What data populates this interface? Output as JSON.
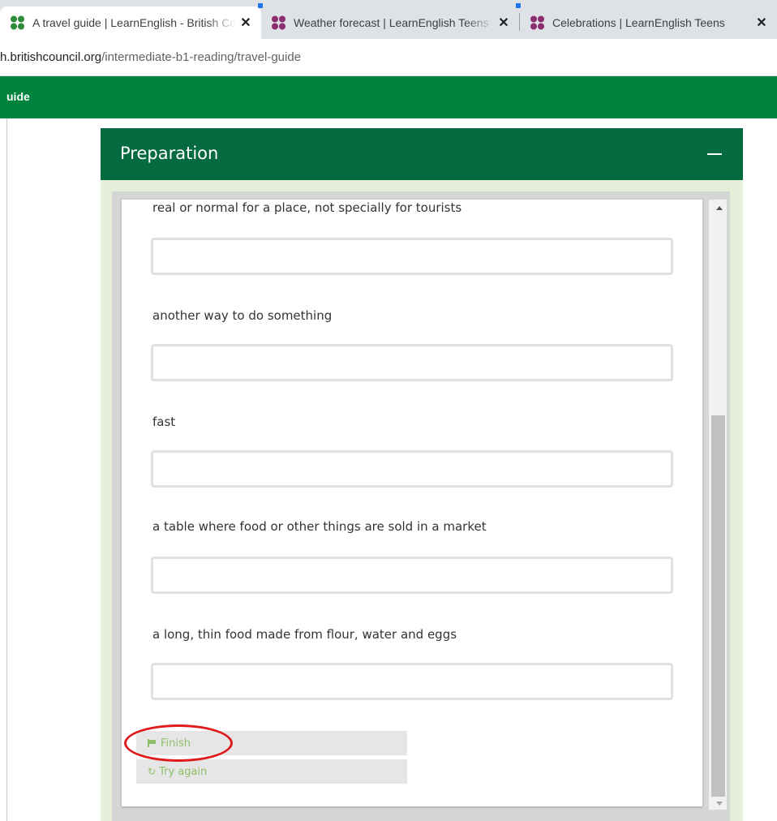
{
  "browser": {
    "tabs": [
      {
        "title": "A travel guide | LearnEnglish - British Council",
        "active": true
      },
      {
        "title": "Weather forecast | LearnEnglish Teens",
        "active": false
      },
      {
        "title": "Celebrations | LearnEnglish Teens",
        "active": false
      }
    ],
    "close_glyph": "✕",
    "url_host": "h.britishcouncil.org",
    "url_path": "/intermediate-b1-reading/travel-guide"
  },
  "site_header": {
    "label": "uide"
  },
  "panel": {
    "title": "Preparation"
  },
  "questions": [
    {
      "prompt": "real or normal for a place, not specially for tourists",
      "value": ""
    },
    {
      "prompt": "another way to do something",
      "value": ""
    },
    {
      "prompt": "fast",
      "value": ""
    },
    {
      "prompt": "a table where food or other things are sold in a market",
      "value": ""
    },
    {
      "prompt": "a long, thin food made from flour, water and eggs",
      "value": ""
    }
  ],
  "buttons": {
    "finish": "Finish",
    "try_again": "Try again"
  },
  "colors": {
    "brand_green": "#00843d",
    "panel_green": "#046a3f",
    "button_text": "#8fbf6a",
    "highlight": "#e01b1b"
  }
}
